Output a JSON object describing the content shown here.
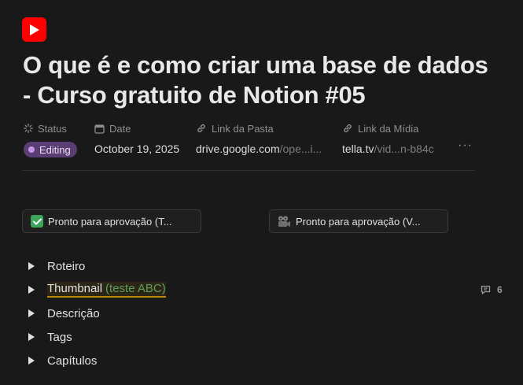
{
  "page": {
    "icon": "youtube-icon",
    "title": "O que é e como criar uma base de dados - Curso gratuito de Notion #05"
  },
  "properties": {
    "status": {
      "label": "Status",
      "value": "Editing",
      "color": "#5a3e73"
    },
    "date": {
      "label": "Date",
      "value": "October 19, 2025"
    },
    "folder_link": {
      "label": "Link da Pasta",
      "value_main": "drive.google.com",
      "value_muted": "/ope...i..."
    },
    "media_link": {
      "label": "Link da Mídia",
      "value_main": "tella.tv",
      "value_muted": "/vid...",
      "value_tail": "n-b84c"
    },
    "more_label": "···"
  },
  "buttons": [
    {
      "icon": "check-mark-emoji",
      "label": "Pronto para aprovação (T..."
    },
    {
      "icon": "film-camera-emoji",
      "label": "Pronto para aprovação (V..."
    }
  ],
  "toggles": [
    {
      "label": "Roteiro"
    },
    {
      "label": "Thumbnail",
      "note": "(teste ABC)"
    },
    {
      "label": "Descrição"
    },
    {
      "label": "Tags"
    },
    {
      "label": "Capítulos"
    }
  ],
  "comments": {
    "count": "6"
  },
  "colors": {
    "background": "#191919",
    "accent_red": "#ff0000",
    "highlight": "#b8860b"
  }
}
